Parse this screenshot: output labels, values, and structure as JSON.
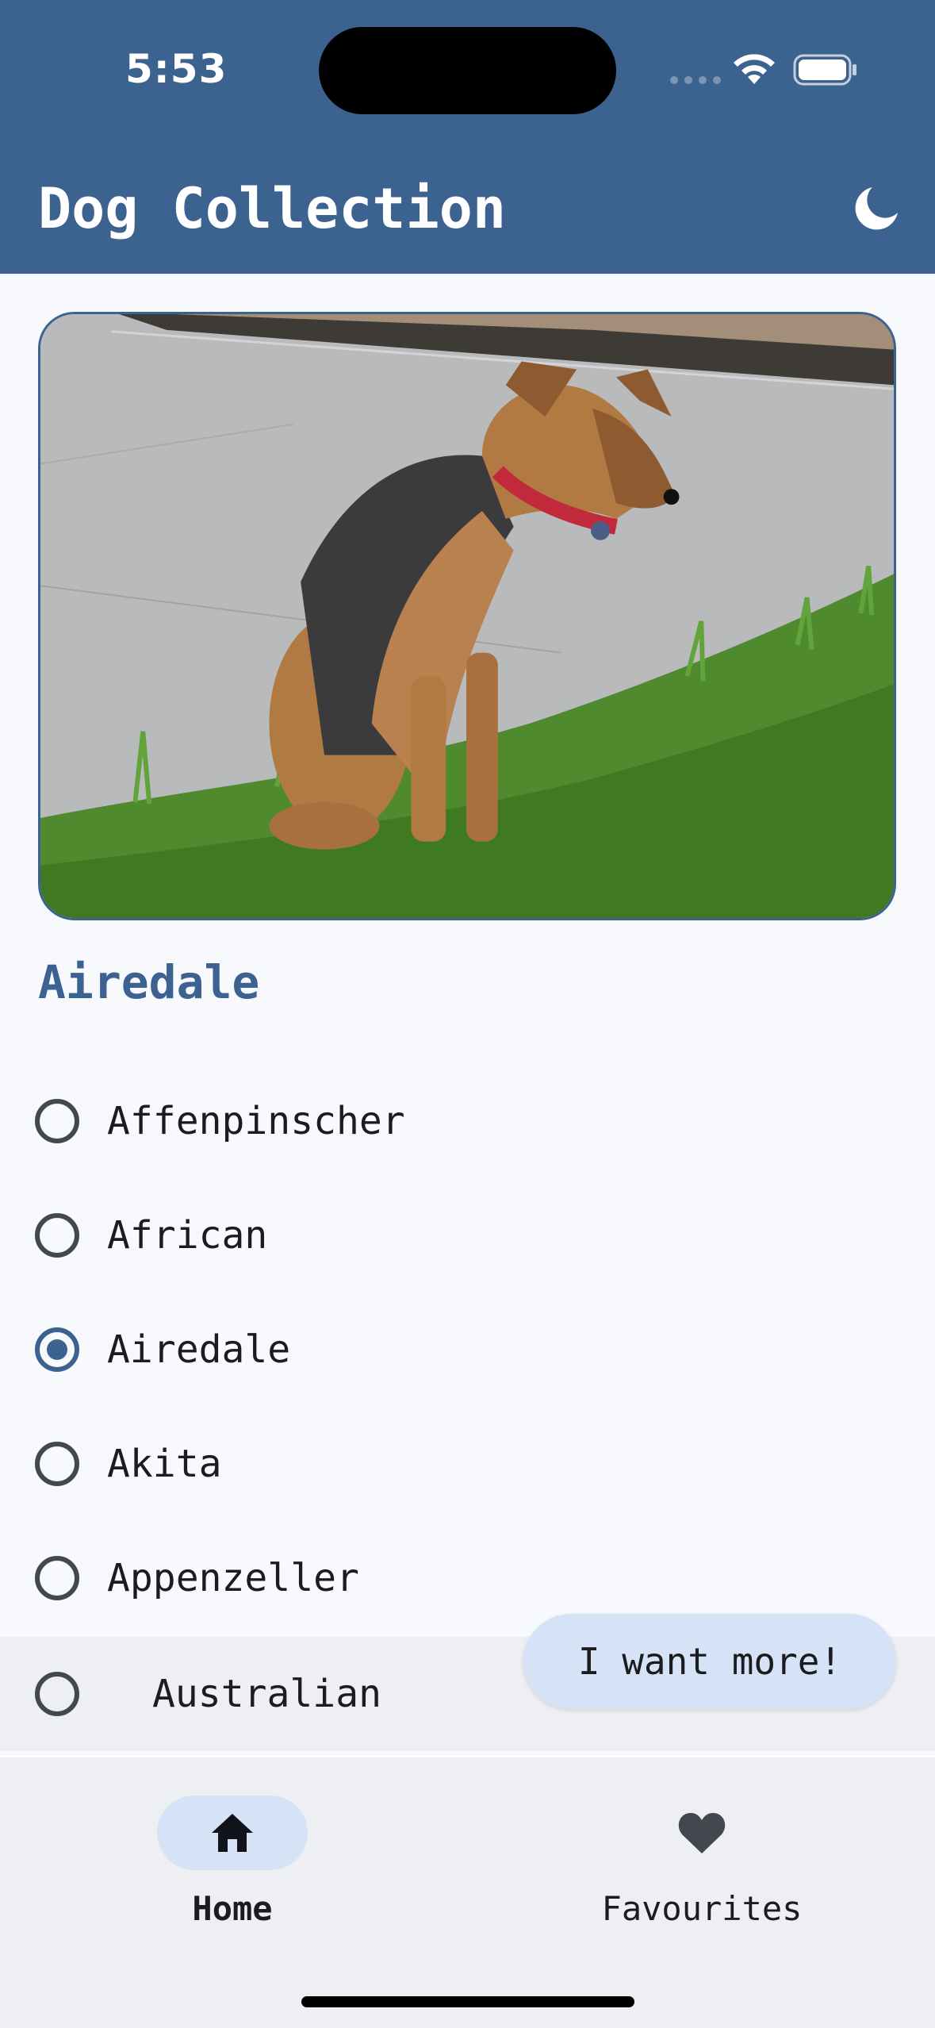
{
  "status_bar": {
    "time": "5:53"
  },
  "header": {
    "title": "Dog Collection",
    "theme_icon": "moon-icon"
  },
  "hero": {
    "alt": "Airedale dog sitting on grass"
  },
  "selected_breed": "Airedale",
  "breeds": [
    {
      "label": "Affenpinscher",
      "checked": false
    },
    {
      "label": "African",
      "checked": false
    },
    {
      "label": "Airedale",
      "checked": true
    },
    {
      "label": "Akita",
      "checked": false
    },
    {
      "label": "Appenzeller",
      "checked": false
    },
    {
      "label": "Australian",
      "checked": false
    }
  ],
  "fab": {
    "label": "I want more!"
  },
  "nav": {
    "home": {
      "label": "Home",
      "icon": "home-icon",
      "active": true
    },
    "favourites": {
      "label": "Favourites",
      "icon": "heart-icon",
      "active": false
    }
  },
  "colors": {
    "primary": "#3c6290",
    "background": "#f7f9fd",
    "secondary_container": "#d6e3f7",
    "surface_container": "#edeff3"
  }
}
